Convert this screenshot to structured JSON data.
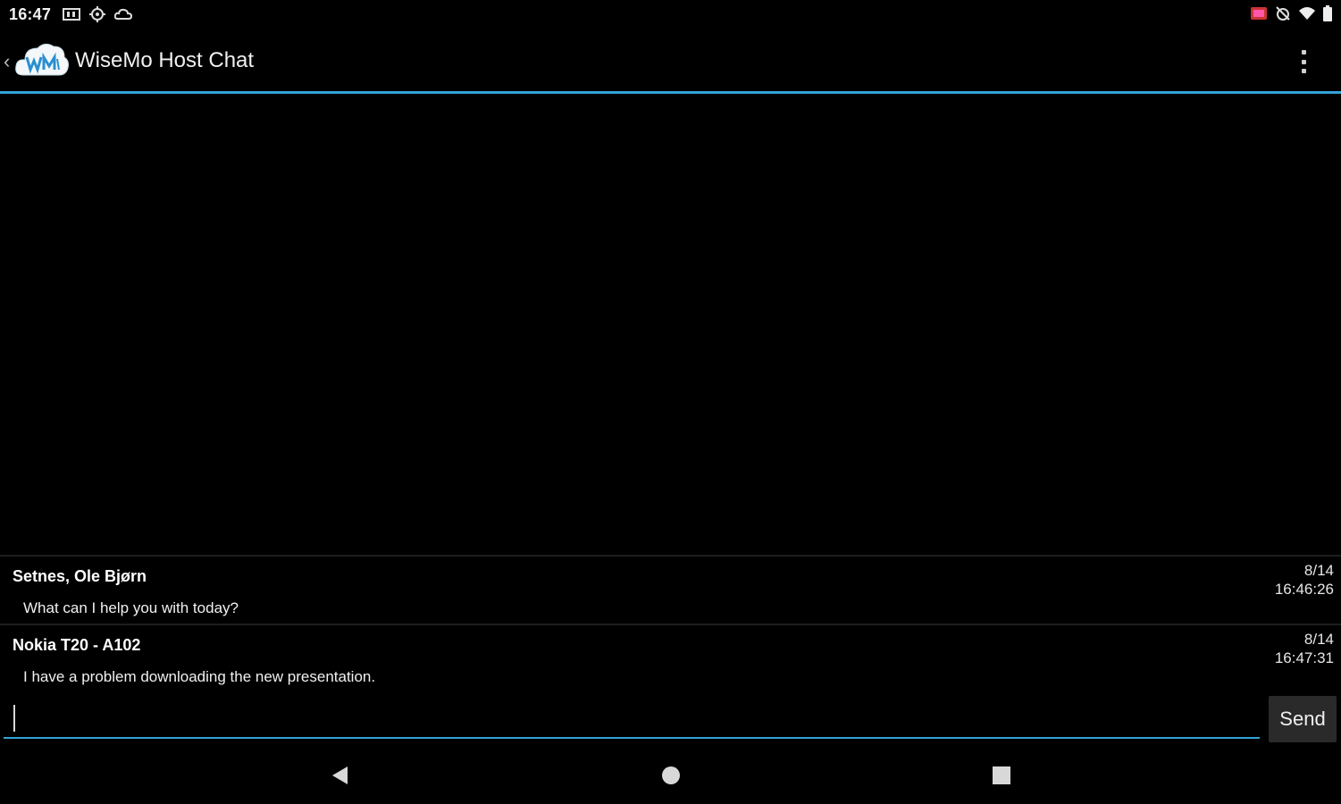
{
  "status_bar": {
    "time": "16:47",
    "icons_left": [
      "media-icon",
      "location-icon",
      "cloud-icon"
    ],
    "icons_right": [
      "cast-icon",
      "alarm-off-icon",
      "wifi-icon",
      "battery-icon"
    ]
  },
  "app_bar": {
    "title": "WiseMo Host Chat",
    "logo_text": "WM",
    "accent_color": "#33a3d6"
  },
  "messages": [
    {
      "sender": "Setnes, Ole Bjørn",
      "text": "What can I help you with today?",
      "date": "8/14",
      "time": "16:46:26"
    },
    {
      "sender": "Nokia T20 - A102",
      "text": "I have a problem downloading the new presentation.",
      "date": "8/14",
      "time": "16:47:31"
    }
  ],
  "composer": {
    "value": "",
    "placeholder": "",
    "send_label": "Send"
  },
  "nav_bar": {
    "buttons": [
      "back-icon",
      "home-icon",
      "recents-icon"
    ]
  }
}
